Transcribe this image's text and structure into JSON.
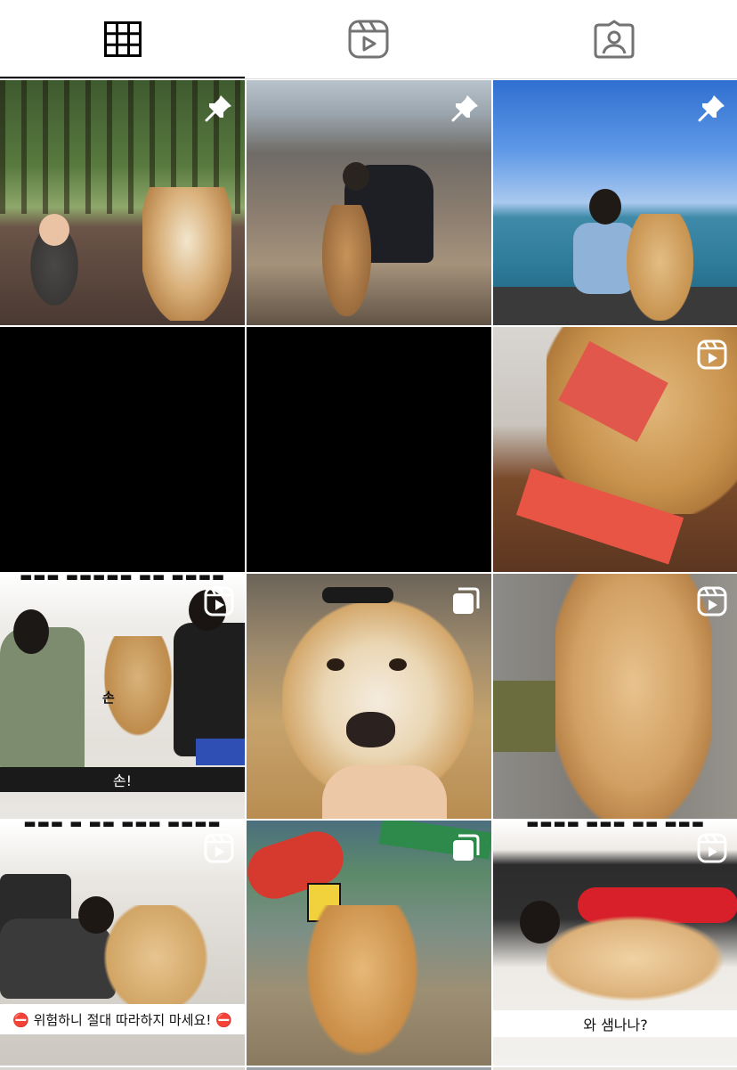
{
  "tabs": [
    {
      "name": "posts",
      "icon": "grid-icon",
      "active": true
    },
    {
      "name": "reels",
      "icon": "reels-icon",
      "active": false
    },
    {
      "name": "tagged",
      "icon": "tagged-icon",
      "active": false
    }
  ],
  "colors": {
    "accent": "#000000",
    "divider": "#dbdbdb",
    "inactive": "#737373"
  },
  "posts": [
    {
      "badge": "pin-icon"
    },
    {
      "badge": "pin-icon"
    },
    {
      "badge": "pin-icon"
    },
    {
      "badge": ""
    },
    {
      "badge": ""
    },
    {
      "badge": "reel-icon"
    },
    {
      "badge": "reel-icon",
      "overlay_caption": "손!",
      "inline_label": "손"
    },
    {
      "badge": "carousel-icon"
    },
    {
      "badge": "reel-icon"
    },
    {
      "badge": "reel-icon",
      "overlay_caption": "⛔ 위험하니 절대 따라하지 마세요! ⛔"
    },
    {
      "badge": "carousel-icon"
    },
    {
      "badge": "reel-icon",
      "overlay_caption": "와 샘나나?"
    }
  ]
}
